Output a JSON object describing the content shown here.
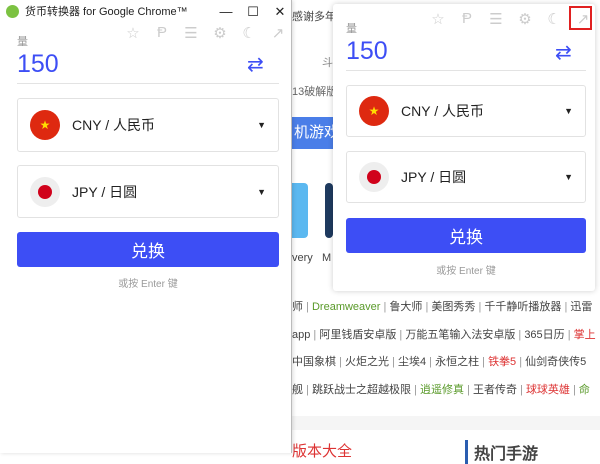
{
  "background": {
    "top_text": "感谢多年",
    "tab_text": "斗",
    "crack_text": "13破解版",
    "banner_text": "机游戏",
    "tile_labels": [
      "very",
      "M"
    ],
    "links": [
      [
        {
          "t": "师",
          "c": ""
        },
        {
          "t": "Dreamweaver",
          "c": "g"
        },
        {
          "t": "鲁大师",
          "c": ""
        },
        {
          "t": "美图秀秀",
          "c": ""
        },
        {
          "t": "千千静听播放器",
          "c": ""
        },
        {
          "t": "迅雷",
          "c": ""
        }
      ],
      [
        {
          "t": "app",
          "c": ""
        },
        {
          "t": "阿里钱盾安卓版",
          "c": ""
        },
        {
          "t": "万能五笔输入法安卓版",
          "c": ""
        },
        {
          "t": "365日历",
          "c": ""
        },
        {
          "t": "掌上",
          "c": "r"
        }
      ],
      [
        {
          "t": "中国象棋",
          "c": ""
        },
        {
          "t": "火炬之光",
          "c": ""
        },
        {
          "t": "尘埃4",
          "c": ""
        },
        {
          "t": "永恒之柱",
          "c": ""
        },
        {
          "t": "铁拳5",
          "c": "r"
        },
        {
          "t": "仙剑奇侠传5",
          "c": ""
        }
      ],
      [
        {
          "t": "舰",
          "c": ""
        },
        {
          "t": "跳跃战士之超越极限",
          "c": ""
        },
        {
          "t": "逍遥修真",
          "c": "g"
        },
        {
          "t": "王者传奇",
          "c": ""
        },
        {
          "t": "球球英雄",
          "c": "r"
        },
        {
          "t": "命",
          "c": "g"
        }
      ]
    ],
    "bottom_left": "版本大全",
    "bottom_right": "热门手游"
  },
  "window": {
    "title": "货币转换器 for Google Chrome™",
    "minimize": "—",
    "maximize": "☐",
    "close": "✕"
  },
  "converter": {
    "amount_label": "量",
    "amount": "150",
    "tools": [
      {
        "name": "star-icon",
        "g": "☆"
      },
      {
        "name": "paypal-icon",
        "g": "Ᵽ"
      },
      {
        "name": "menu-icon",
        "g": "☰"
      },
      {
        "name": "gear-icon",
        "g": "⚙"
      },
      {
        "name": "moon-icon",
        "g": "☾"
      },
      {
        "name": "popout-icon",
        "g": "↗"
      }
    ],
    "swap_icon": "⇄",
    "from": {
      "code": "CNY / 人民币",
      "flag": "★"
    },
    "to": {
      "code": "JPY / 日圆"
    },
    "convert_label": "兑换",
    "hint": "或按 Enter 键"
  },
  "colors": {
    "accent": "#3d4ef5",
    "highlight": "#e02020"
  }
}
